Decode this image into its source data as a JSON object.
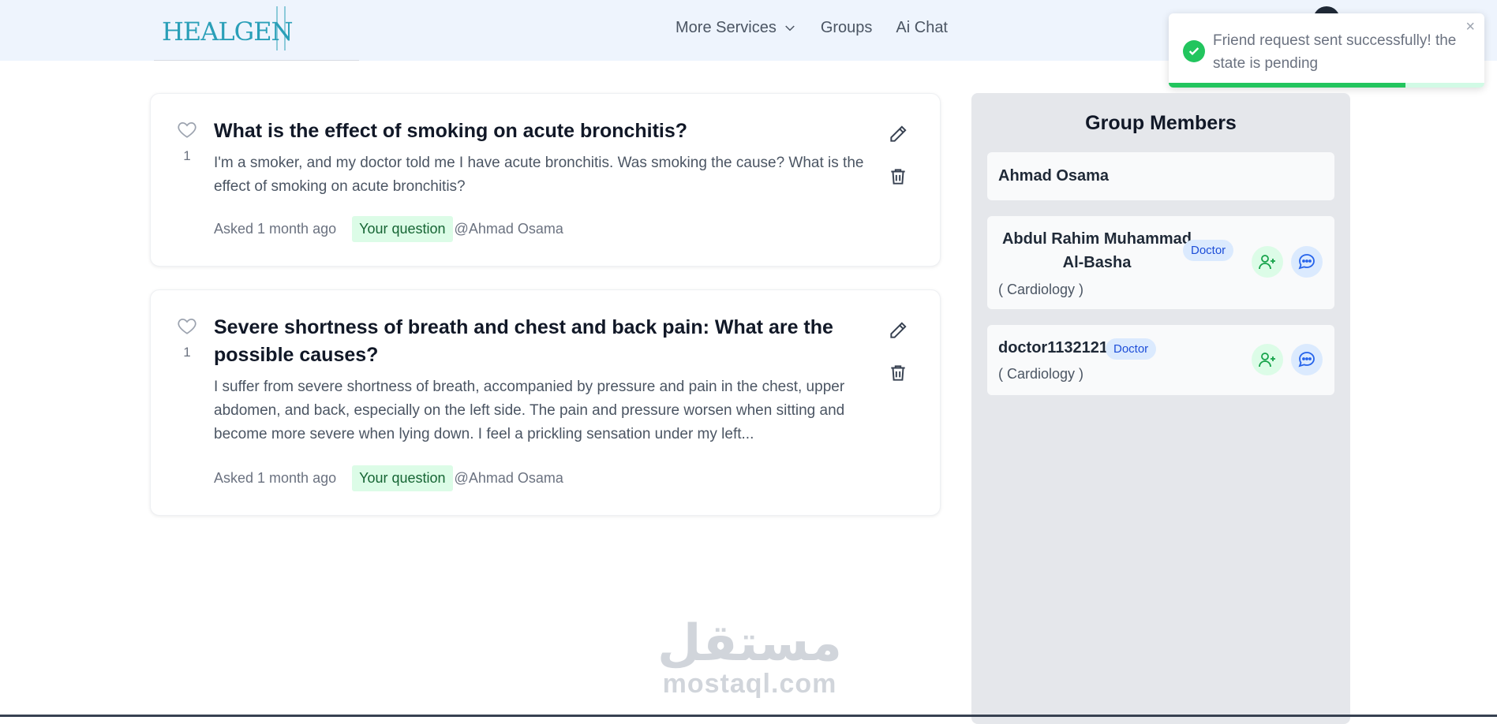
{
  "header": {
    "logo_text": "HEALGEN",
    "nav": [
      {
        "label": "More Services"
      },
      {
        "label": "Groups"
      },
      {
        "label": "Ai Chat"
      }
    ]
  },
  "toast": {
    "message": "Friend request sent successfully! the state is pending",
    "close": "×",
    "progress": 0.75,
    "color": "#22c55e"
  },
  "questions": [
    {
      "likes": "1",
      "title": "What is the effect of smoking on acute bronchitis?",
      "body": "I'm a smoker, and my doctor told me I have acute bronchitis. Was smoking the cause? What is the effect of smoking on acute bronchitis?",
      "asked": "Asked 1 month ago",
      "tag": "Your question",
      "author": "@Ahmad Osama"
    },
    {
      "likes": "1",
      "title": "Severe shortness of breath and chest and back pain: What are the possible causes?",
      "body": "I suffer from severe shortness of breath, accompanied by pressure and pain in the chest, upper abdomen, and back, especially on the left side. The pain and pressure worsen when sitting and become more severe when lying down. I feel a prickling sensation under my left...",
      "asked": "Asked 1 month ago",
      "tag": "Your question",
      "author": "@Ahmad Osama"
    }
  ],
  "sidebar": {
    "title": "Group Members",
    "members": [
      {
        "name": "Ahmad Osama"
      },
      {
        "name": "Abdul Rahim Muhammad Al-Basha",
        "badge": "Doctor",
        "specialty": "( Cardiology )"
      },
      {
        "name": "doctor1132121",
        "badge": "Doctor",
        "specialty": "( Cardiology )"
      }
    ]
  },
  "watermark": {
    "arabic": "مستقل",
    "latin": "mostaql.com"
  },
  "colors": {
    "accent": "#2a9fb8",
    "success": "#22c55e",
    "badge_bg": "#dbeafe"
  }
}
